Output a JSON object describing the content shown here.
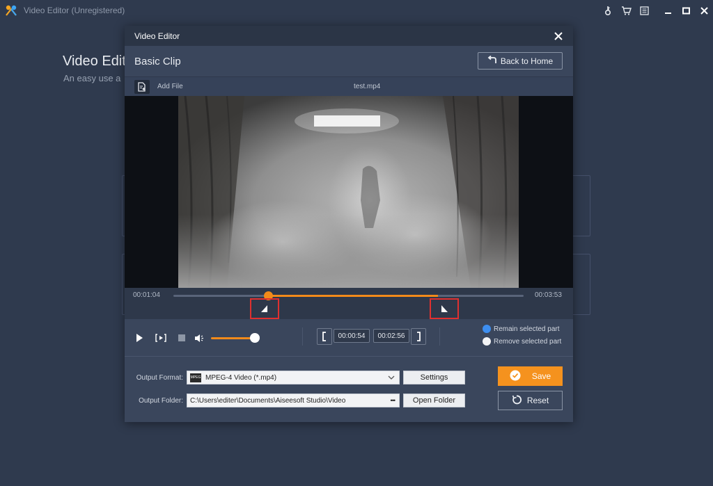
{
  "app": {
    "title": "Video Editor (Unregistered)",
    "heading": "Video Edit",
    "subheading": "An easy use a"
  },
  "top_icons": [
    "key-icon",
    "cart-icon",
    "feedback-icon"
  ],
  "window_controls": [
    "minimize-icon",
    "maximize-icon",
    "close-icon"
  ],
  "dialog": {
    "title": "Video Editor",
    "header_title": "Basic Clip",
    "back_home_label": "Back to Home",
    "add_file_label": "Add File",
    "file_name": "test.mp4"
  },
  "timeline": {
    "time_start": "00:01:04",
    "time_end": "00:03:53",
    "selection_start_fraction": 0.27,
    "selection_end_fraction": 0.755,
    "playhead_fraction": 0.27
  },
  "controls": {
    "volume_fraction": 0.88,
    "clip_start": "00:00:54",
    "clip_end": "00:02:56",
    "remain_label": "Remain selected part",
    "remove_label": "Remove selected part",
    "selected_option": "remain"
  },
  "output": {
    "format_label": "Output Format:",
    "format_value": "MPEG-4 Video (*.mp4)",
    "format_badge": "MPEG",
    "settings_label": "Settings",
    "folder_label": "Output Folder:",
    "folder_value": "C:\\Users\\editer\\Documents\\Aiseesoft Studio\\Video",
    "folder_dots": "•••",
    "open_folder_label": "Open Folder",
    "save_label": "Save",
    "reset_label": "Reset"
  },
  "colors": {
    "accent": "#f5921e",
    "radio_selected": "#3d8ef0",
    "highlight_box": "#e0302f"
  }
}
